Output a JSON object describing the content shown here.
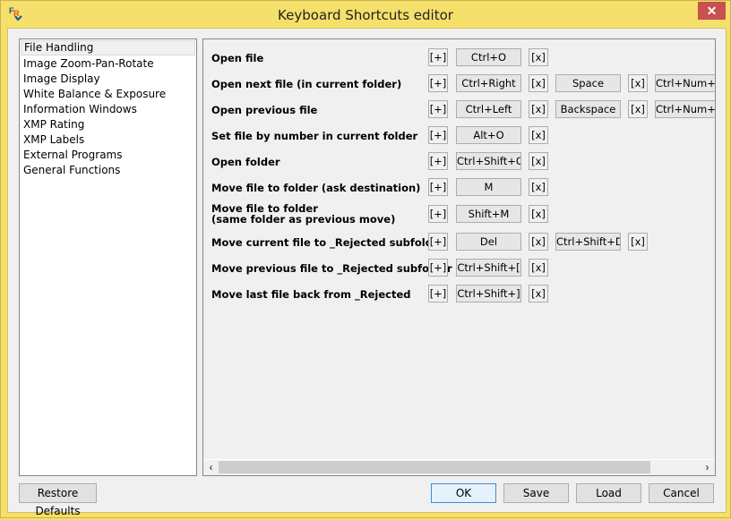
{
  "window": {
    "title": "Keyboard Shortcuts editor",
    "close_label": "✕",
    "accent_color": "#f4e06b",
    "close_color": "#c75050"
  },
  "sidebar": {
    "items": [
      {
        "label": "File Handling",
        "selected": true
      },
      {
        "label": "Image Zoom-Pan-Rotate"
      },
      {
        "label": "Image Display"
      },
      {
        "label": "White Balance & Exposure"
      },
      {
        "label": "Information Windows"
      },
      {
        "label": "XMP Rating"
      },
      {
        "label": "XMP Labels"
      },
      {
        "label": "External Programs"
      },
      {
        "label": "General Functions"
      }
    ]
  },
  "shortcuts": {
    "add_label": "[+]",
    "remove_label": "[x]",
    "rows": [
      {
        "label": "Open file",
        "keys": [
          "Ctrl+O"
        ]
      },
      {
        "label": "Open next file (in current folder)",
        "keys": [
          "Ctrl+Right",
          "Space",
          "Ctrl+Num+Right"
        ]
      },
      {
        "label": "Open previous file",
        "keys": [
          "Ctrl+Left",
          "Backspace",
          "Ctrl+Num+Left"
        ]
      },
      {
        "label": "Set file by number in current folder",
        "keys": [
          "Alt+O"
        ]
      },
      {
        "label": "Open folder",
        "keys": [
          "Ctrl+Shift+O"
        ]
      },
      {
        "label": "Move file to folder (ask destination)",
        "keys": [
          "M"
        ]
      },
      {
        "label": "Move file to folder\n(same folder as previous move)",
        "keys": [
          "Shift+M"
        ]
      },
      {
        "label": "Move current file to _Rejected subfolder",
        "keys": [
          "Del",
          "Ctrl+Shift+Del"
        ]
      },
      {
        "label": "Move previous file to _Rejected subfolder",
        "keys": [
          "Ctrl+Shift+["
        ]
      },
      {
        "label": "Move last file back from _Rejected",
        "keys": [
          "Ctrl+Shift+]"
        ]
      }
    ]
  },
  "scrollbar": {
    "left_arrow": "‹",
    "right_arrow": "›"
  },
  "footer": {
    "restore_defaults": "Restore Defaults",
    "ok": "OK",
    "save": "Save",
    "load": "Load",
    "cancel": "Cancel"
  }
}
